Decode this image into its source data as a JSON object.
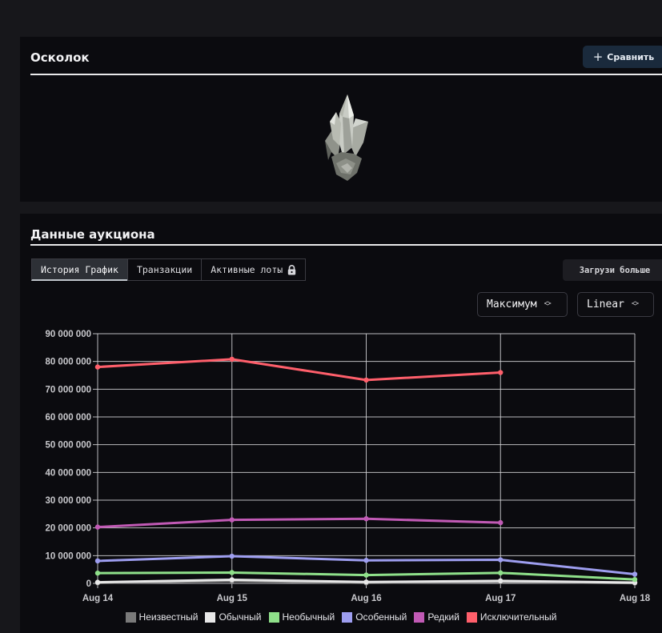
{
  "item": {
    "title": "Осколок",
    "compare_label": "Сравнить"
  },
  "auction": {
    "title": "Данные аукциона",
    "tabs": [
      {
        "label": "История График",
        "active": true
      },
      {
        "label": "Транзакции",
        "active": false
      },
      {
        "label": "Активные лоты",
        "active": false,
        "icon": "lock-icon"
      }
    ],
    "load_more_label": "Загрузи больше",
    "range_select": "Максимум",
    "scale_select": "Linear"
  },
  "chart_data": {
    "type": "line",
    "x": [
      "Aug 14",
      "Aug 15",
      "Aug 16",
      "Aug 17",
      "Aug 18"
    ],
    "ylim": [
      0,
      90000000
    ],
    "yticks": [
      "0",
      "10 000 000",
      "20 000 000",
      "30 000 000",
      "40 000 000",
      "50 000 000",
      "60 000 000",
      "70 000 000",
      "80 000 000",
      "90 000 000"
    ],
    "grid": true,
    "legend_position": "bottom",
    "series": [
      {
        "name": "Неизвестный",
        "color": "#7a7a7a",
        "values": [
          200000,
          900000,
          200000,
          600000,
          100000
        ]
      },
      {
        "name": "Обычный",
        "color": "#e8e8e8",
        "values": [
          400000,
          1300000,
          500000,
          900000,
          300000
        ]
      },
      {
        "name": "Необычный",
        "color": "#8fe08a",
        "values": [
          3700000,
          3900000,
          3000000,
          3800000,
          1400000
        ]
      },
      {
        "name": "Особенный",
        "color": "#9e9ef0",
        "values": [
          8100000,
          9800000,
          8300000,
          8500000,
          3300000
        ]
      },
      {
        "name": "Редкий",
        "color": "#c15ab5",
        "values": [
          20300000,
          22900000,
          23300000,
          21900000,
          null
        ]
      },
      {
        "name": "Исключительный",
        "color": "#ff5f6b",
        "values": [
          78000000,
          80800000,
          73300000,
          76000000,
          null
        ]
      }
    ]
  }
}
